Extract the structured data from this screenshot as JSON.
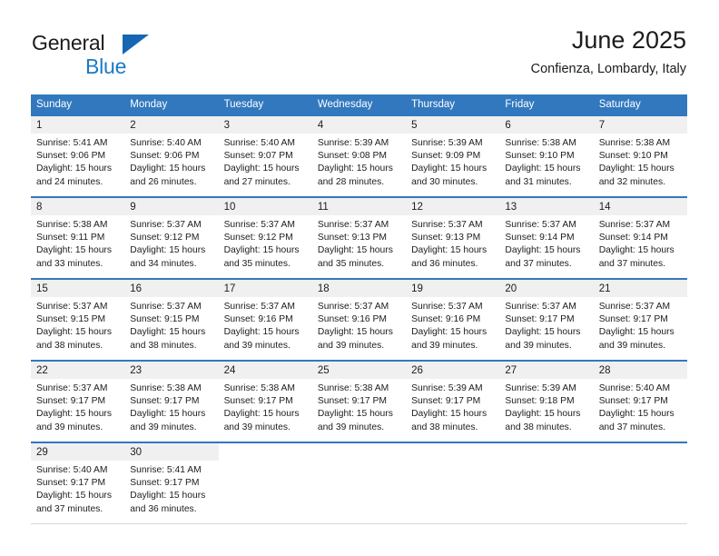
{
  "brand": {
    "name_part1": "General",
    "name_part2": "Blue",
    "triangle_icon": "triangle-icon",
    "color_primary": "#1b7ac4",
    "color_text": "#1c1c1c"
  },
  "header": {
    "title": "June 2025",
    "subtitle": "Confienza, Lombardy, Italy"
  },
  "calendar": {
    "accent_color": "#3278be",
    "daynum_band_color": "#f0f0f0",
    "weekday_headers": [
      "Sunday",
      "Monday",
      "Tuesday",
      "Wednesday",
      "Thursday",
      "Friday",
      "Saturday"
    ],
    "weeks": [
      [
        {
          "day": "1",
          "sunrise": "Sunrise: 5:41 AM",
          "sunset": "Sunset: 9:06 PM",
          "daylight_line1": "Daylight: 15 hours",
          "daylight_line2": "and 24 minutes."
        },
        {
          "day": "2",
          "sunrise": "Sunrise: 5:40 AM",
          "sunset": "Sunset: 9:06 PM",
          "daylight_line1": "Daylight: 15 hours",
          "daylight_line2": "and 26 minutes."
        },
        {
          "day": "3",
          "sunrise": "Sunrise: 5:40 AM",
          "sunset": "Sunset: 9:07 PM",
          "daylight_line1": "Daylight: 15 hours",
          "daylight_line2": "and 27 minutes."
        },
        {
          "day": "4",
          "sunrise": "Sunrise: 5:39 AM",
          "sunset": "Sunset: 9:08 PM",
          "daylight_line1": "Daylight: 15 hours",
          "daylight_line2": "and 28 minutes."
        },
        {
          "day": "5",
          "sunrise": "Sunrise: 5:39 AM",
          "sunset": "Sunset: 9:09 PM",
          "daylight_line1": "Daylight: 15 hours",
          "daylight_line2": "and 30 minutes."
        },
        {
          "day": "6",
          "sunrise": "Sunrise: 5:38 AM",
          "sunset": "Sunset: 9:10 PM",
          "daylight_line1": "Daylight: 15 hours",
          "daylight_line2": "and 31 minutes."
        },
        {
          "day": "7",
          "sunrise": "Sunrise: 5:38 AM",
          "sunset": "Sunset: 9:10 PM",
          "daylight_line1": "Daylight: 15 hours",
          "daylight_line2": "and 32 minutes."
        }
      ],
      [
        {
          "day": "8",
          "sunrise": "Sunrise: 5:38 AM",
          "sunset": "Sunset: 9:11 PM",
          "daylight_line1": "Daylight: 15 hours",
          "daylight_line2": "and 33 minutes."
        },
        {
          "day": "9",
          "sunrise": "Sunrise: 5:37 AM",
          "sunset": "Sunset: 9:12 PM",
          "daylight_line1": "Daylight: 15 hours",
          "daylight_line2": "and 34 minutes."
        },
        {
          "day": "10",
          "sunrise": "Sunrise: 5:37 AM",
          "sunset": "Sunset: 9:12 PM",
          "daylight_line1": "Daylight: 15 hours",
          "daylight_line2": "and 35 minutes."
        },
        {
          "day": "11",
          "sunrise": "Sunrise: 5:37 AM",
          "sunset": "Sunset: 9:13 PM",
          "daylight_line1": "Daylight: 15 hours",
          "daylight_line2": "and 35 minutes."
        },
        {
          "day": "12",
          "sunrise": "Sunrise: 5:37 AM",
          "sunset": "Sunset: 9:13 PM",
          "daylight_line1": "Daylight: 15 hours",
          "daylight_line2": "and 36 minutes."
        },
        {
          "day": "13",
          "sunrise": "Sunrise: 5:37 AM",
          "sunset": "Sunset: 9:14 PM",
          "daylight_line1": "Daylight: 15 hours",
          "daylight_line2": "and 37 minutes."
        },
        {
          "day": "14",
          "sunrise": "Sunrise: 5:37 AM",
          "sunset": "Sunset: 9:14 PM",
          "daylight_line1": "Daylight: 15 hours",
          "daylight_line2": "and 37 minutes."
        }
      ],
      [
        {
          "day": "15",
          "sunrise": "Sunrise: 5:37 AM",
          "sunset": "Sunset: 9:15 PM",
          "daylight_line1": "Daylight: 15 hours",
          "daylight_line2": "and 38 minutes."
        },
        {
          "day": "16",
          "sunrise": "Sunrise: 5:37 AM",
          "sunset": "Sunset: 9:15 PM",
          "daylight_line1": "Daylight: 15 hours",
          "daylight_line2": "and 38 minutes."
        },
        {
          "day": "17",
          "sunrise": "Sunrise: 5:37 AM",
          "sunset": "Sunset: 9:16 PM",
          "daylight_line1": "Daylight: 15 hours",
          "daylight_line2": "and 39 minutes."
        },
        {
          "day": "18",
          "sunrise": "Sunrise: 5:37 AM",
          "sunset": "Sunset: 9:16 PM",
          "daylight_line1": "Daylight: 15 hours",
          "daylight_line2": "and 39 minutes."
        },
        {
          "day": "19",
          "sunrise": "Sunrise: 5:37 AM",
          "sunset": "Sunset: 9:16 PM",
          "daylight_line1": "Daylight: 15 hours",
          "daylight_line2": "and 39 minutes."
        },
        {
          "day": "20",
          "sunrise": "Sunrise: 5:37 AM",
          "sunset": "Sunset: 9:17 PM",
          "daylight_line1": "Daylight: 15 hours",
          "daylight_line2": "and 39 minutes."
        },
        {
          "day": "21",
          "sunrise": "Sunrise: 5:37 AM",
          "sunset": "Sunset: 9:17 PM",
          "daylight_line1": "Daylight: 15 hours",
          "daylight_line2": "and 39 minutes."
        }
      ],
      [
        {
          "day": "22",
          "sunrise": "Sunrise: 5:37 AM",
          "sunset": "Sunset: 9:17 PM",
          "daylight_line1": "Daylight: 15 hours",
          "daylight_line2": "and 39 minutes."
        },
        {
          "day": "23",
          "sunrise": "Sunrise: 5:38 AM",
          "sunset": "Sunset: 9:17 PM",
          "daylight_line1": "Daylight: 15 hours",
          "daylight_line2": "and 39 minutes."
        },
        {
          "day": "24",
          "sunrise": "Sunrise: 5:38 AM",
          "sunset": "Sunset: 9:17 PM",
          "daylight_line1": "Daylight: 15 hours",
          "daylight_line2": "and 39 minutes."
        },
        {
          "day": "25",
          "sunrise": "Sunrise: 5:38 AM",
          "sunset": "Sunset: 9:17 PM",
          "daylight_line1": "Daylight: 15 hours",
          "daylight_line2": "and 39 minutes."
        },
        {
          "day": "26",
          "sunrise": "Sunrise: 5:39 AM",
          "sunset": "Sunset: 9:17 PM",
          "daylight_line1": "Daylight: 15 hours",
          "daylight_line2": "and 38 minutes."
        },
        {
          "day": "27",
          "sunrise": "Sunrise: 5:39 AM",
          "sunset": "Sunset: 9:18 PM",
          "daylight_line1": "Daylight: 15 hours",
          "daylight_line2": "and 38 minutes."
        },
        {
          "day": "28",
          "sunrise": "Sunrise: 5:40 AM",
          "sunset": "Sunset: 9:17 PM",
          "daylight_line1": "Daylight: 15 hours",
          "daylight_line2": "and 37 minutes."
        }
      ],
      [
        {
          "day": "29",
          "sunrise": "Sunrise: 5:40 AM",
          "sunset": "Sunset: 9:17 PM",
          "daylight_line1": "Daylight: 15 hours",
          "daylight_line2": "and 37 minutes."
        },
        {
          "day": "30",
          "sunrise": "Sunrise: 5:41 AM",
          "sunset": "Sunset: 9:17 PM",
          "daylight_line1": "Daylight: 15 hours",
          "daylight_line2": "and 36 minutes."
        },
        null,
        null,
        null,
        null,
        null
      ]
    ]
  }
}
